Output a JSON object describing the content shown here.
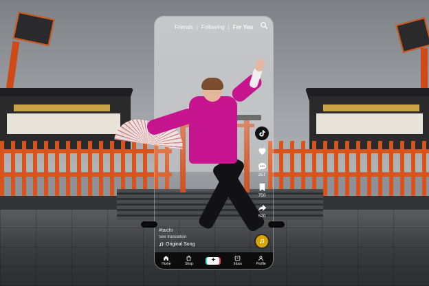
{
  "top_nav": {
    "tabs": [
      {
        "label": "Friends"
      },
      {
        "label": "Following"
      },
      {
        "label": "For You"
      }
    ],
    "separator": "|"
  },
  "icons": {
    "search": "search-icon",
    "logo": "tiktok-logo-icon",
    "like": "heart-icon",
    "comment": "comment-icon",
    "bookmark": "bookmark-icon",
    "share": "share-icon",
    "music_disc": "music-disc-icon"
  },
  "right_rail": {
    "comments_count": "257",
    "bookmarks_count": "750",
    "shares_count": "520"
  },
  "caption": {
    "handle": "#taichi",
    "see_translation": "See translation",
    "song": "Original Song"
  },
  "bottom_nav": {
    "home": "Home",
    "shop": "Shop",
    "create": "+",
    "inbox": "Inbox",
    "profile": "Profile"
  },
  "colors": {
    "accent_cyan": "#25f4ee",
    "accent_red": "#fe2c55",
    "nav_bg": "#0c0c0d"
  }
}
